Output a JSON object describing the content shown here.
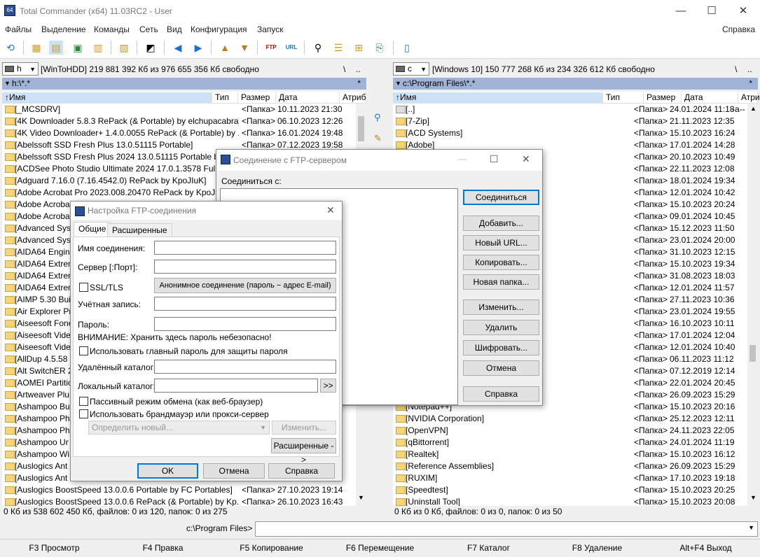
{
  "window": {
    "title": "Total Commander (x64) 11.03RC2 - User",
    "min": "—",
    "max": "☐",
    "close": "✕"
  },
  "menu": [
    "Файлы",
    "Выделение",
    "Команды",
    "Сеть",
    "Вид",
    "Конфигурация",
    "Запуск",
    "Справка"
  ],
  "toolbar_icons": [
    "refresh-icon",
    "brief-view-icon",
    "detailed-view-icon",
    "thumbnails-icon",
    "tree-icon",
    "compare-dirs-icon",
    "invert-selection-icon",
    "back-icon",
    "forward-icon",
    "pack-icon",
    "unpack-icon",
    "ftp-connect-icon",
    "url-connect-icon",
    "search-icon",
    "rename-multi-icon",
    "sync-dirs-icon",
    "copy-names-icon",
    "notepad-icon"
  ],
  "left": {
    "drive": "h",
    "drive_info": "[WinToHDD]  219 881 392 Кб из 976 655 356 Кб свободно",
    "path": "h:\\*.*",
    "root": "\\",
    "up": "..",
    "filter": "*",
    "cols": {
      "name": "↑Имя",
      "type": "Тип",
      "size": "Размер",
      "date": "Дата",
      "attr": "Атриб"
    },
    "rows": [
      {
        "n": "[_MCSDRV]",
        "s": "<Папка>",
        "d": "10.11.2023 21:30",
        "a": "—"
      },
      {
        "n": "[4K Downloader 5.8.3 RePack (& Portable) by elchupacabra]",
        "s": "<Папка>",
        "d": "06.10.2023 12:26",
        "a": "—"
      },
      {
        "n": "[4K Video Downloader+ 1.4.0.0055 RePack (& Portable) by ..]",
        "s": "<Папка>",
        "d": "16.01.2024 19:48",
        "a": "—"
      },
      {
        "n": "[Abelssoft SSD Fresh Plus 13.0.51115 Portable]",
        "s": "<Папка>",
        "d": "07.12.2023 19:58",
        "a": "—"
      },
      {
        "n": "[Abelssoft SSD Fresh Plus 2024 13.0.51115 Portable by F",
        "s": "",
        "d": "",
        "a": ""
      },
      {
        "n": "[ACDSee Photo Studio Ultimate 2024 17.0.1.3578 Full",
        "s": "",
        "d": "",
        "a": ""
      },
      {
        "n": "[Adguard 7.16.0 (7.16.4542.0) RePack by KpoJIuK]",
        "s": "",
        "d": "",
        "a": ""
      },
      {
        "n": "[Adobe Acrobat Pro 2023.008.20470 RePack by KpoJIuK",
        "s": "",
        "d": "",
        "a": ""
      },
      {
        "n": "[Adobe Acrobat",
        "s": "",
        "d": "",
        "a": ""
      },
      {
        "n": "[Adobe Acrobat",
        "s": "",
        "d": "",
        "a": ""
      },
      {
        "n": "[Advanced Sys",
        "s": "",
        "d": "",
        "a": ""
      },
      {
        "n": "[Advanced Sys",
        "s": "",
        "d": "",
        "a": ""
      },
      {
        "n": "[AIDA64 Engin",
        "s": "",
        "d": "",
        "a": ""
      },
      {
        "n": "[AIDA64 Extren",
        "s": "",
        "d": "",
        "a": ""
      },
      {
        "n": "[AIDA64 Extren",
        "s": "",
        "d": "",
        "a": ""
      },
      {
        "n": "[AIDA64 Extren",
        "s": "",
        "d": "",
        "a": ""
      },
      {
        "n": "[AIMP 5.30 Bui",
        "s": "",
        "d": "",
        "a": ""
      },
      {
        "n": "[Air Explorer Pr",
        "s": "",
        "d": "",
        "a": ""
      },
      {
        "n": "[Aiseesoft Fone",
        "s": "",
        "d": "",
        "a": ""
      },
      {
        "n": "[Aiseesoft Vide",
        "s": "",
        "d": "",
        "a": ""
      },
      {
        "n": "[Aiseesoft Vide",
        "s": "",
        "d": "",
        "a": ""
      },
      {
        "n": "[AllDup 4.5.58",
        "s": "",
        "d": "",
        "a": ""
      },
      {
        "n": "[Alt SwitchER 2",
        "s": "",
        "d": "",
        "a": ""
      },
      {
        "n": "[AOMEI Partitio",
        "s": "",
        "d": "",
        "a": ""
      },
      {
        "n": "[Artweaver Plu",
        "s": "",
        "d": "",
        "a": ""
      },
      {
        "n": "[Ashampoo Bu",
        "s": "",
        "d": "",
        "a": ""
      },
      {
        "n": "[Ashampoo Ph",
        "s": "",
        "d": "",
        "a": ""
      },
      {
        "n": "[Ashampoo Ph",
        "s": "",
        "d": "",
        "a": ""
      },
      {
        "n": "[Ashampoo Ur",
        "s": "",
        "d": "",
        "a": ""
      },
      {
        "n": "[Ashampoo Wi",
        "s": "",
        "d": "",
        "a": ""
      },
      {
        "n": "[Auslogics Ant",
        "s": "",
        "d": "",
        "a": ""
      },
      {
        "n": "[Auslogics Ant",
        "s": "",
        "d": "",
        "a": ""
      },
      {
        "n": "[Auslogics BoostSpeed 13.0.0.6 Portable by FC Portables]",
        "s": "<Папка>",
        "d": "27.10.2023 19:14",
        "a": "—"
      },
      {
        "n": "[Auslogics BoostSpeed 13.0.0.6 RePack (& Portable) by Kp..]",
        "s": "<Папка>",
        "d": "26.10.2023 16:43",
        "a": "—"
      }
    ],
    "status": "0 Кб из 538 602 450 Кб, файлов: 0 из 120, папок: 0 из 275"
  },
  "right": {
    "drive": "c",
    "drive_info": "[Windows 10]  150 777 268 Кб из 234 326 612 Кб свободно",
    "path": "c:\\Program Files\\*.*",
    "root": "\\",
    "up": "..",
    "filter": "*",
    "cols": {
      "name": "↑Имя",
      "type": "Тип",
      "size": "Размер",
      "date": "Дата",
      "attr": "Атриб"
    },
    "rows": [
      {
        "n": "[..]",
        "s": "<Папка>",
        "d": "24.01.2024 11:18",
        "a": "-a--"
      },
      {
        "n": "[7-Zip]",
        "s": "<Папка>",
        "d": "21.11.2023 12:35",
        "a": "—"
      },
      {
        "n": "[ACD Systems]",
        "s": "<Папка>",
        "d": "15.10.2023 16:24",
        "a": "—"
      },
      {
        "n": "[Adobe]",
        "s": "<Папка>",
        "d": "17.01.2024 14:28",
        "a": "—"
      },
      {
        "n": "",
        "s": "<Папка>",
        "d": "20.10.2023 10:49",
        "a": "—"
      },
      {
        "n": "",
        "s": "<Папка>",
        "d": "22.11.2023 12:08",
        "a": "—"
      },
      {
        "n": "",
        "s": "<Папка>",
        "d": "18.01.2024 19:34",
        "a": "—"
      },
      {
        "n": "",
        "s": "<Папка>",
        "d": "12.01.2024 10:42",
        "a": "—"
      },
      {
        "n": "",
        "s": "<Папка>",
        "d": "15.10.2023 20:24",
        "a": "—"
      },
      {
        "n": "",
        "s": "<Папка>",
        "d": "09.01.2024 10:45",
        "a": "—"
      },
      {
        "n": "",
        "s": "<Папка>",
        "d": "15.12.2023 11:50",
        "a": "—"
      },
      {
        "n": "",
        "s": "<Папка>",
        "d": "23.01.2024 20:00",
        "a": "—"
      },
      {
        "n": "",
        "s": "<Папка>",
        "d": "31.10.2023 12:15",
        "a": "—"
      },
      {
        "n": "",
        "s": "<Папка>",
        "d": "15.10.2023 19:34",
        "a": "—"
      },
      {
        "n": "",
        "s": "<Папка>",
        "d": "31.08.2023 18:03",
        "a": "—"
      },
      {
        "n": "",
        "s": "<Папка>",
        "d": "12.01.2024 11:57",
        "a": "—"
      },
      {
        "n": "",
        "s": "<Папка>",
        "d": "27.11.2023 10:36",
        "a": "—"
      },
      {
        "n": "",
        "s": "<Папка>",
        "d": "23.01.2024 19:55",
        "a": "—"
      },
      {
        "n": "",
        "s": "<Папка>",
        "d": "16.10.2023 10:11",
        "a": "—"
      },
      {
        "n": "",
        "s": "<Папка>",
        "d": "17.01.2024 12:04",
        "a": "—"
      },
      {
        "n": "",
        "s": "<Папка>",
        "d": "12.01.2024 10:40",
        "a": "—"
      },
      {
        "n": "",
        "s": "<Папка>",
        "d": "06.11.2023 11:12",
        "a": "—"
      },
      {
        "n": "",
        "s": "<Папка>",
        "d": "07.12.2019 12:14",
        "a": "—"
      },
      {
        "n": "",
        "s": "<Папка>",
        "d": "22.01.2024 20:45",
        "a": "—"
      },
      {
        "n": "",
        "s": "<Папка>",
        "d": "26.09.2023 15:29",
        "a": "—"
      },
      {
        "n": "[Notepad++]",
        "s": "<Папка>",
        "d": "15.10.2023 20:16",
        "a": "—"
      },
      {
        "n": "[NVIDIA Corporation]",
        "s": "<Папка>",
        "d": "25.12.2023 12:11",
        "a": "—"
      },
      {
        "n": "[OpenVPN]",
        "s": "<Папка>",
        "d": "24.11.2023 22:05",
        "a": "—"
      },
      {
        "n": "[qBittorrent]",
        "s": "<Папка>",
        "d": "24.01.2024 11:19",
        "a": "—"
      },
      {
        "n": "[Realtek]",
        "s": "<Папка>",
        "d": "15.10.2023 16:12",
        "a": "—"
      },
      {
        "n": "[Reference Assemblies]",
        "s": "<Папка>",
        "d": "26.09.2023 15:29",
        "a": "—"
      },
      {
        "n": "[RUXIM]",
        "s": "<Папка>",
        "d": "17.10.2023 19:18",
        "a": "—"
      },
      {
        "n": "[Speedtest]",
        "s": "<Папка>",
        "d": "15.10.2023 20:25",
        "a": "—"
      },
      {
        "n": "[Uninstall Tool]",
        "s": "<Папка>",
        "d": "15.10.2023 20:08",
        "a": "—"
      }
    ],
    "status": "0 Кб из 0 Кб, файлов: 0 из 0, папок: 0 из 50"
  },
  "cmdline": {
    "prompt": "c:\\Program Files>",
    "value": ""
  },
  "fkeys": [
    "F3 Просмотр",
    "F4 Правка",
    "F5 Копирование",
    "F6 Перемещение",
    "F7 Каталог",
    "F8 Удаление",
    "Alt+F4 Выход"
  ],
  "ftp_dialog": {
    "title": "Соединение с FTP-сервером",
    "connect_to": "Соединиться с:",
    "buttons": [
      "Соединиться",
      "Добавить...",
      "Новый URL...",
      "Копировать...",
      "Новая папка...",
      "Изменить...",
      "Удалить",
      "Шифровать...",
      "Отмена",
      "Справка"
    ]
  },
  "settings_dialog": {
    "title": "Настройка FTP-соединения",
    "tabs": [
      "Общие",
      "Расширенные"
    ],
    "conn_name": "Имя соединения:",
    "server": "Сервер [:Порт]:",
    "ssl": "SSL/TLS",
    "anon_btn": "Анонимное соединение (пароль − адрес E-mail)",
    "account": "Учётная запись:",
    "password": "Пароль:",
    "warning": "ВНИМАНИЕ: Хранить здесь пароль небезопасно!",
    "master_pw": "Использовать главный пароль для защиты пароля",
    "remote_dir": "Удалённый каталог:",
    "local_dir": "Локальный каталог:",
    "browse": ">>",
    "passive": "Пассивный режим обмена (как веб-браузер)",
    "firewall": "Использовать брандмауэр или прокси-сервер",
    "define_new": "Определить новый...",
    "change": "Изменить...",
    "advanced": "Расширенные ->",
    "ok": "OK",
    "cancel": "Отмена",
    "help": "Справка"
  }
}
